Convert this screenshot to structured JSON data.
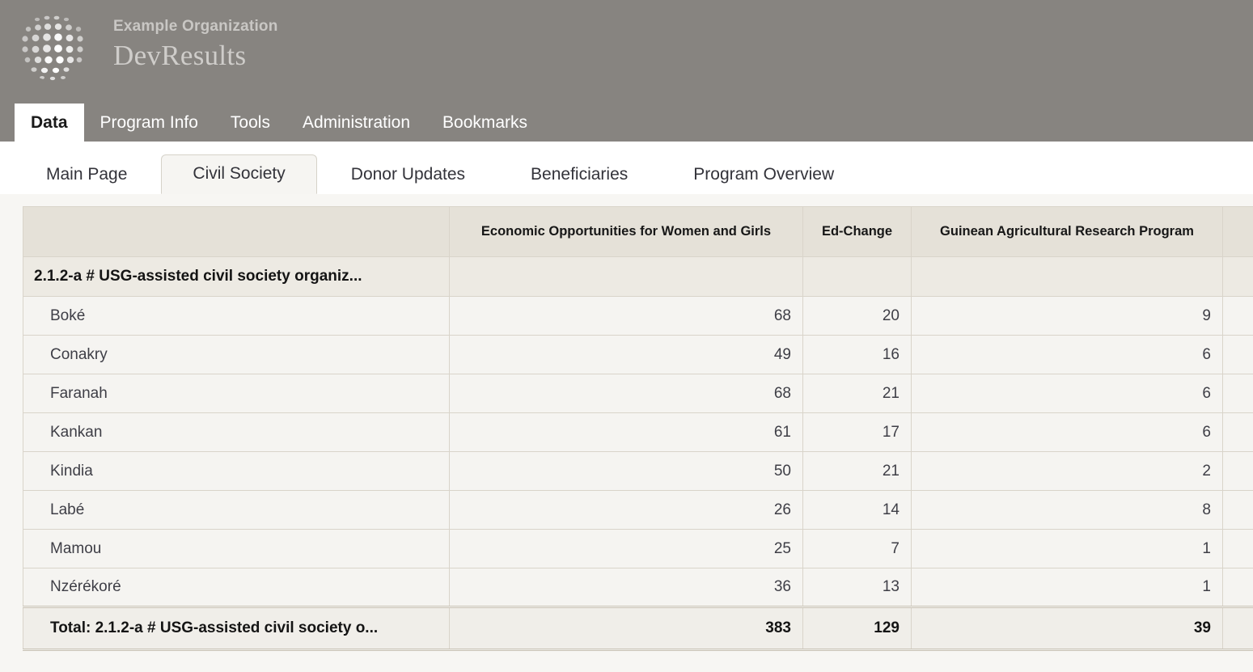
{
  "header": {
    "organization": "Example Organization",
    "product": "DevResults",
    "logo_icon": "globe-dots-logo",
    "background_color": "#878480"
  },
  "primary_nav": {
    "items": [
      {
        "label": "Data",
        "active": true
      },
      {
        "label": "Program Info",
        "active": false
      },
      {
        "label": "Tools",
        "active": false
      },
      {
        "label": "Administration",
        "active": false
      },
      {
        "label": "Bookmarks",
        "active": false
      }
    ]
  },
  "secondary_nav": {
    "items": [
      {
        "label": "Main Page",
        "active": false
      },
      {
        "label": "Civil Society",
        "active": true
      },
      {
        "label": "Donor Updates",
        "active": false
      },
      {
        "label": "Beneficiaries",
        "active": false
      },
      {
        "label": "Program Overview",
        "active": false
      }
    ]
  },
  "table": {
    "corner_header": "",
    "columns": [
      "Economic Opportunities for Women and Girls",
      "Ed-Change",
      "Guinean Agricultural Research Program",
      ""
    ],
    "indicator": {
      "label": "2.1.2-a # USG-assisted civil society organiz...",
      "values": [
        "",
        "",
        "",
        ""
      ]
    },
    "rows": [
      {
        "label": "Boké",
        "values": [
          "68",
          "20",
          "9",
          ""
        ]
      },
      {
        "label": "Conakry",
        "values": [
          "49",
          "16",
          "6",
          ""
        ]
      },
      {
        "label": "Faranah",
        "values": [
          "68",
          "21",
          "6",
          ""
        ]
      },
      {
        "label": "Kankan",
        "values": [
          "61",
          "17",
          "6",
          ""
        ]
      },
      {
        "label": "Kindia",
        "values": [
          "50",
          "21",
          "2",
          ""
        ]
      },
      {
        "label": "Labé",
        "values": [
          "26",
          "14",
          "8",
          ""
        ]
      },
      {
        "label": "Mamou",
        "values": [
          "25",
          "7",
          "1",
          ""
        ]
      },
      {
        "label": "Nzérékoré",
        "values": [
          "36",
          "13",
          "1",
          ""
        ]
      }
    ],
    "total": {
      "label": "Total: 2.1.2-a # USG-assisted civil society o...",
      "values": [
        "383",
        "129",
        "39",
        ""
      ]
    },
    "colors": {
      "header_bg": "#e5e1d8",
      "indicator_bg": "#edeae3",
      "row_bg": "#f5f4f1",
      "total_bg": "#f0eee9",
      "border": "#d9d4ca",
      "page_bg": "#f7f6f3"
    }
  }
}
